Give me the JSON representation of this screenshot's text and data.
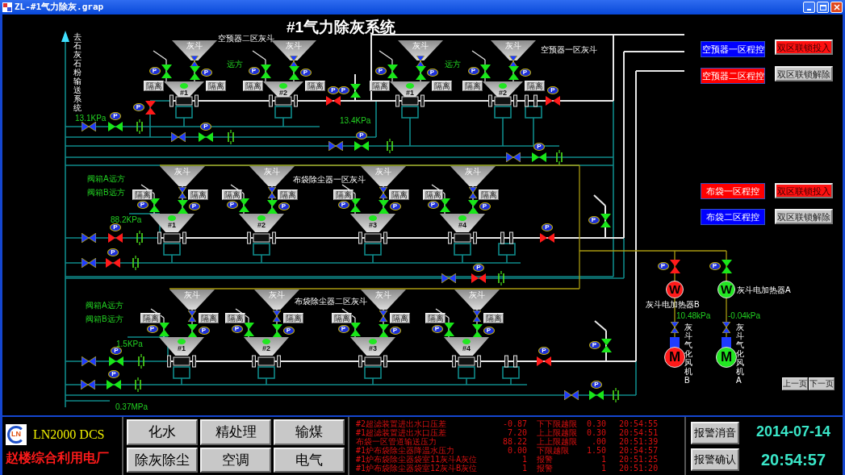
{
  "window": {
    "title": "ZL-#1气力除灰.grap"
  },
  "page_title": "#1气力除灰系统",
  "outlet_label": "去石灰石粉输送系统",
  "sections": [
    {
      "captions": [
        "空预器二区灰斗",
        "空预器一区灰斗"
      ],
      "mode_labels": [
        "远方",
        "远方"
      ],
      "pressures": [
        "13.1KPa",
        "13.4KPa"
      ],
      "units": [
        {
          "hopper": "灰斗",
          "number": "#1",
          "running": true,
          "isolate": [
            "隔离",
            "隔离"
          ],
          "valves": [
            {
              "kind": "manual"
            },
            {
              "kind": "actuated",
              "open": true,
              "actuator": "P"
            },
            {
              "kind": "actuated",
              "open": true,
              "actuator": "P"
            }
          ]
        },
        {
          "hopper": "灰斗",
          "number": "#2",
          "running": true,
          "isolate": [
            "隔离",
            "隔离"
          ],
          "valves": [
            {
              "kind": "manual"
            },
            {
              "kind": "actuated",
              "open": true,
              "actuator": "P"
            },
            {
              "kind": "actuated",
              "open": true,
              "actuator": "P"
            }
          ]
        },
        {
          "hopper": "灰斗",
          "number": "#1",
          "running": true,
          "isolate": [
            "隔离",
            "隔离"
          ],
          "valves": [
            {
              "kind": "manual"
            },
            {
              "kind": "actuated",
              "open": true,
              "actuator": "P"
            },
            {
              "kind": "actuated",
              "open": true,
              "actuator": "P"
            }
          ]
        },
        {
          "hopper": "灰斗",
          "number": "#2",
          "running": true,
          "isolate": [
            "隔离",
            "隔离"
          ],
          "valves": [
            {
              "kind": "manual"
            },
            {
              "kind": "actuated",
              "open": true,
              "actuator": "P"
            },
            {
              "kind": "actuated",
              "open": true,
              "actuator": "P"
            }
          ]
        }
      ],
      "valves": [
        {
          "kind": "actuated",
          "open": false,
          "actuator": "P"
        },
        {
          "kind": "actuated",
          "open": false,
          "actuator": "P"
        },
        {
          "kind": "actuated",
          "open": true,
          "actuator": "P"
        },
        {
          "kind": "actuated",
          "open": false,
          "actuator": "P"
        },
        {
          "kind": "manual"
        },
        {
          "kind": "actuated",
          "open": true,
          "actuator": "P"
        },
        {
          "kind": "manual"
        },
        {
          "kind": "actuated",
          "open": true,
          "actuator": "P"
        },
        {
          "kind": "manual"
        },
        {
          "kind": "actuated",
          "open": true,
          "actuator": "P"
        },
        {
          "kind": "manual"
        },
        {
          "kind": "actuated",
          "open": true,
          "actuator": "P"
        }
      ]
    },
    {
      "captions": [
        "布袋除尘器一区灰斗"
      ],
      "mode_labels": [
        "阀箱A远方",
        "阀箱B远方"
      ],
      "pressures": [
        "88.2KPa"
      ],
      "units": [
        {
          "hopper": "灰斗",
          "number": "#1",
          "running": true,
          "isolate": [
            "隔离",
            "隔离"
          ],
          "valves": [
            {
              "kind": "manual"
            },
            {
              "kind": "actuated",
              "open": true,
              "actuator": "P"
            },
            {
              "kind": "actuated",
              "open": true,
              "actuator": "P"
            }
          ]
        },
        {
          "hopper": "灰斗",
          "number": "#2",
          "running": true,
          "isolate": [
            "隔离",
            "隔离"
          ],
          "valves": [
            {
              "kind": "manual"
            },
            {
              "kind": "actuated",
              "open": true,
              "actuator": "P"
            },
            {
              "kind": "actuated",
              "open": true,
              "actuator": "P"
            }
          ]
        },
        {
          "hopper": "灰斗",
          "number": "#3",
          "running": true,
          "isolate": [
            "隔离",
            "隔离"
          ],
          "valves": [
            {
              "kind": "manual"
            },
            {
              "kind": "actuated",
              "open": true,
              "actuator": "P"
            },
            {
              "kind": "actuated",
              "open": true,
              "actuator": "P"
            }
          ]
        },
        {
          "hopper": "灰斗",
          "number": "#4",
          "running": true,
          "isolate": [
            "隔离",
            "隔离"
          ],
          "valves": [
            {
              "kind": "manual"
            },
            {
              "kind": "actuated",
              "open": true,
              "actuator": "P"
            },
            {
              "kind": "actuated",
              "open": true,
              "actuator": "P"
            }
          ]
        }
      ],
      "valves": [
        {
          "kind": "actuated",
          "open": false,
          "actuator": "P"
        },
        {
          "kind": "actuated",
          "open": true,
          "actuator": "P"
        },
        {
          "kind": "manual"
        },
        {
          "kind": "actuated",
          "open": false,
          "actuator": "P"
        },
        {
          "kind": "manual"
        },
        {
          "kind": "actuated",
          "open": false,
          "actuator": "P"
        },
        {
          "kind": "manual"
        },
        {
          "kind": "actuated",
          "open": false,
          "actuator": "P"
        }
      ]
    },
    {
      "captions": [
        "布袋除尘器二区灰斗"
      ],
      "mode_labels": [
        "阀箱A远方",
        "阀箱B远方"
      ],
      "pressures": [
        "1.5KPa",
        "0.37MPa"
      ],
      "units": [
        {
          "hopper": "灰斗",
          "number": "#1",
          "running": true,
          "isolate": [
            "隔离",
            "隔离"
          ],
          "valves": [
            {
              "kind": "manual"
            },
            {
              "kind": "actuated",
              "open": true,
              "actuator": "P"
            },
            {
              "kind": "actuated",
              "open": true,
              "actuator": "P"
            }
          ]
        },
        {
          "hopper": "灰斗",
          "number": "#2",
          "running": true,
          "isolate": [
            "隔离",
            "隔离"
          ],
          "valves": [
            {
              "kind": "manual"
            },
            {
              "kind": "actuated",
              "open": true,
              "actuator": "P"
            },
            {
              "kind": "actuated",
              "open": true,
              "actuator": "P"
            }
          ]
        },
        {
          "hopper": "灰斗",
          "number": "#3",
          "running": true,
          "isolate": [
            "隔离",
            "隔离"
          ],
          "valves": [
            {
              "kind": "manual"
            },
            {
              "kind": "actuated",
              "open": true,
              "actuator": "P"
            },
            {
              "kind": "actuated",
              "open": true,
              "actuator": "P"
            }
          ]
        },
        {
          "hopper": "灰斗",
          "number": "#4",
          "running": true,
          "isolate": [
            "隔离",
            "隔离"
          ],
          "valves": [
            {
              "kind": "manual"
            },
            {
              "kind": "actuated",
              "open": true,
              "actuator": "P"
            },
            {
              "kind": "actuated",
              "open": true,
              "actuator": "P"
            }
          ]
        }
      ],
      "valves": [
        {
          "kind": "actuated",
          "open": false,
          "actuator": "P"
        },
        {
          "kind": "actuated",
          "open": true,
          "actuator": "P"
        },
        {
          "kind": "manual"
        },
        {
          "kind": "actuated",
          "open": true,
          "actuator": "P"
        },
        {
          "kind": "manual"
        },
        {
          "kind": "actuated",
          "open": true,
          "actuator": "P"
        },
        {
          "kind": "manual"
        },
        {
          "kind": "actuated",
          "open": true,
          "actuator": "P"
        }
      ]
    }
  ],
  "heaters": [
    {
      "valve": {
        "kind": "actuated",
        "open": false,
        "actuator": "P"
      },
      "heater_symbol": "W",
      "heater_on": false,
      "heater_label": "灰斗电加热器B",
      "pressure": "10.48kPa",
      "manual_valve": {
        "kind": "manual"
      },
      "motor_symbol": "M",
      "motor_running": false,
      "motor_label": "灰斗气化风机B"
    },
    {
      "valve": {
        "kind": "actuated",
        "open": true,
        "actuator": "P"
      },
      "heater_symbol": "W",
      "heater_on": true,
      "heater_label": "灰斗电加热器A",
      "pressure": "-0.04kPa",
      "manual_valve": {
        "kind": "manual"
      },
      "motor_symbol": "M",
      "motor_running": true,
      "motor_label": "灰斗气化风机A"
    }
  ],
  "programs": [
    {
      "label": "空预器一区程控",
      "color": "#0000ff"
    },
    {
      "label": "空预器二区程控",
      "color": "#ff0000"
    },
    {
      "label": "布袋一区程控",
      "color": "#ff0000"
    },
    {
      "label": "布袋二区程控",
      "color": "#0000ff"
    }
  ],
  "interlocks": [
    {
      "label": "双区联锁投入",
      "on": true
    },
    {
      "label": "双区联锁解除",
      "on": false
    },
    {
      "label": "双区联锁投入",
      "on": true
    },
    {
      "label": "双区联锁解除",
      "on": false
    }
  ],
  "paging": [
    "上一页",
    "下一页"
  ],
  "footer": {
    "logo": "LN",
    "system": "LN2000 DCS",
    "plant": "赵楼综合利用电厂",
    "nav": [
      "化水",
      "精处理",
      "输煤",
      "除灰除尘",
      "空调",
      "电气"
    ],
    "alarms": [
      {
        "name": "#2超滤装置进出水口压差",
        "value": "-0.87",
        "type": "下下限越限",
        "limit": "0.30",
        "time": "20:54:55"
      },
      {
        "name": "#1超滤装置进出水口压差",
        "value": "7.20",
        "type": "上上限越限",
        "limit": "0.30",
        "time": "20:54:51"
      },
      {
        "name": "布袋一区管道输送压力",
        "value": "88.22",
        "type": "上上限越限",
        "limit": ".00",
        "time": "20:51:39"
      },
      {
        "name": "#1炉布袋除尘器降温水压力",
        "value": "0.00",
        "type": "下限越限",
        "limit": "1.50",
        "time": "20:54:57"
      },
      {
        "name": "#1炉布袋除尘器袋室11灰斗A灰位",
        "value": "1",
        "type": "报警",
        "limit": "1",
        "time": "20:51:25"
      },
      {
        "name": "#1炉布袋除尘器袋室12灰斗B灰位",
        "value": "1",
        "type": "报警",
        "limit": "1",
        "time": "20:51:20"
      }
    ],
    "alarm_buttons": [
      "报警消音",
      "报警确认"
    ],
    "date": "2014-07-14",
    "time": "20:54:57"
  }
}
